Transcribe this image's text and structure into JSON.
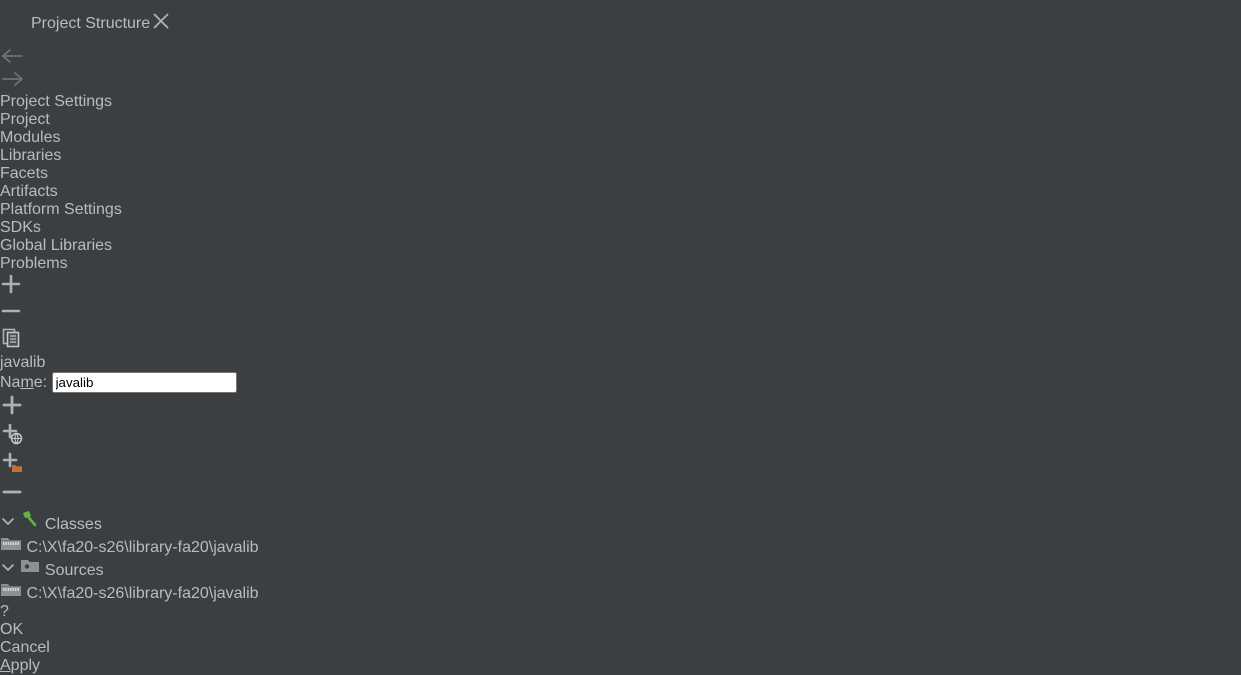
{
  "window": {
    "title": "Project Structure",
    "app_icon": "intellij-idea-icon",
    "close_icon": "close-icon"
  },
  "sidebar": {
    "nav": {
      "back_icon": "arrow-left-icon",
      "forward_icon": "arrow-right-icon"
    },
    "groups": [
      {
        "heading": "Project Settings",
        "items": [
          {
            "label": "Project",
            "selected": false
          },
          {
            "label": "Modules",
            "selected": false
          },
          {
            "label": "Libraries",
            "selected": true
          },
          {
            "label": "Facets",
            "selected": false
          },
          {
            "label": "Artifacts",
            "selected": false
          }
        ]
      },
      {
        "heading": "Platform Settings",
        "items": [
          {
            "label": "SDKs",
            "selected": false
          },
          {
            "label": "Global Libraries",
            "selected": false
          }
        ]
      }
    ],
    "footer_item": {
      "label": "Problems"
    }
  },
  "list_pane": {
    "toolbar": [
      {
        "name": "add-library-button",
        "icon": "plus-icon"
      },
      {
        "name": "remove-library-button",
        "icon": "minus-icon"
      },
      {
        "name": "copy-library-button",
        "icon": "copy-icon"
      }
    ],
    "libraries": [
      {
        "name": "javalib",
        "icon": "library-books-icon",
        "selected": true
      }
    ]
  },
  "detail": {
    "name_label_before": "Na",
    "name_label_mnemonic": "m",
    "name_label_after": "e:",
    "name_value": "javalib",
    "name_placeholder": "",
    "toolbar": [
      {
        "name": "add-button",
        "icon": "plus-icon"
      },
      {
        "name": "add-from-maven-button",
        "icon": "plus-globe-icon"
      },
      {
        "name": "add-directory-button",
        "icon": "plus-folder-icon"
      },
      {
        "name": "remove-button",
        "icon": "minus-icon"
      }
    ],
    "tree": [
      {
        "label": "Classes",
        "icon": "hammer-classes-icon",
        "expanded": true,
        "chevron": "chevron-down-icon",
        "children": [
          {
            "label": "C:\\X\\fa20-s26\\library-fa20\\javalib",
            "icon": "jar-archive-icon"
          }
        ]
      },
      {
        "label": "Sources",
        "icon": "sources-folder-icon",
        "expanded": true,
        "chevron": "chevron-down-icon",
        "children": [
          {
            "label": "C:\\X\\fa20-s26\\library-fa20\\javalib",
            "icon": "jar-archive-icon"
          }
        ]
      }
    ]
  },
  "footer": {
    "help_label": "?",
    "ok_label": "OK",
    "cancel_label": "Cancel",
    "apply_mnemonic": "A",
    "apply_rest": "pply"
  },
  "colors": {
    "background": "#3c3f41",
    "selection": "#4b6eaf",
    "primary_button": "#365880",
    "text": "#b6b8ba",
    "classes_icon": "#62b543",
    "folder_accent": "#c0703a"
  }
}
